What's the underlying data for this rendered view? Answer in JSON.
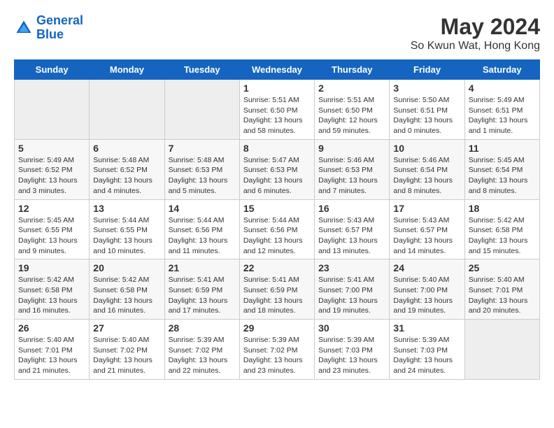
{
  "logo": {
    "line1": "General",
    "line2": "Blue"
  },
  "title": "May 2024",
  "subtitle": "So Kwun Wat, Hong Kong",
  "days_of_week": [
    "Sunday",
    "Monday",
    "Tuesday",
    "Wednesday",
    "Thursday",
    "Friday",
    "Saturday"
  ],
  "weeks": [
    [
      {
        "num": "",
        "detail": ""
      },
      {
        "num": "",
        "detail": ""
      },
      {
        "num": "",
        "detail": ""
      },
      {
        "num": "1",
        "detail": "Sunrise: 5:51 AM\nSunset: 6:50 PM\nDaylight: 13 hours\nand 58 minutes."
      },
      {
        "num": "2",
        "detail": "Sunrise: 5:51 AM\nSunset: 6:50 PM\nDaylight: 12 hours\nand 59 minutes."
      },
      {
        "num": "3",
        "detail": "Sunrise: 5:50 AM\nSunset: 6:51 PM\nDaylight: 13 hours\nand 0 minutes."
      },
      {
        "num": "4",
        "detail": "Sunrise: 5:49 AM\nSunset: 6:51 PM\nDaylight: 13 hours\nand 1 minute."
      }
    ],
    [
      {
        "num": "5",
        "detail": "Sunrise: 5:49 AM\nSunset: 6:52 PM\nDaylight: 13 hours\nand 3 minutes."
      },
      {
        "num": "6",
        "detail": "Sunrise: 5:48 AM\nSunset: 6:52 PM\nDaylight: 13 hours\nand 4 minutes."
      },
      {
        "num": "7",
        "detail": "Sunrise: 5:48 AM\nSunset: 6:53 PM\nDaylight: 13 hours\nand 5 minutes."
      },
      {
        "num": "8",
        "detail": "Sunrise: 5:47 AM\nSunset: 6:53 PM\nDaylight: 13 hours\nand 6 minutes."
      },
      {
        "num": "9",
        "detail": "Sunrise: 5:46 AM\nSunset: 6:53 PM\nDaylight: 13 hours\nand 7 minutes."
      },
      {
        "num": "10",
        "detail": "Sunrise: 5:46 AM\nSunset: 6:54 PM\nDaylight: 13 hours\nand 8 minutes."
      },
      {
        "num": "11",
        "detail": "Sunrise: 5:45 AM\nSunset: 6:54 PM\nDaylight: 13 hours\nand 8 minutes."
      }
    ],
    [
      {
        "num": "12",
        "detail": "Sunrise: 5:45 AM\nSunset: 6:55 PM\nDaylight: 13 hours\nand 9 minutes."
      },
      {
        "num": "13",
        "detail": "Sunrise: 5:44 AM\nSunset: 6:55 PM\nDaylight: 13 hours\nand 10 minutes."
      },
      {
        "num": "14",
        "detail": "Sunrise: 5:44 AM\nSunset: 6:56 PM\nDaylight: 13 hours\nand 11 minutes."
      },
      {
        "num": "15",
        "detail": "Sunrise: 5:44 AM\nSunset: 6:56 PM\nDaylight: 13 hours\nand 12 minutes."
      },
      {
        "num": "16",
        "detail": "Sunrise: 5:43 AM\nSunset: 6:57 PM\nDaylight: 13 hours\nand 13 minutes."
      },
      {
        "num": "17",
        "detail": "Sunrise: 5:43 AM\nSunset: 6:57 PM\nDaylight: 13 hours\nand 14 minutes."
      },
      {
        "num": "18",
        "detail": "Sunrise: 5:42 AM\nSunset: 6:58 PM\nDaylight: 13 hours\nand 15 minutes."
      }
    ],
    [
      {
        "num": "19",
        "detail": "Sunrise: 5:42 AM\nSunset: 6:58 PM\nDaylight: 13 hours\nand 16 minutes."
      },
      {
        "num": "20",
        "detail": "Sunrise: 5:42 AM\nSunset: 6:58 PM\nDaylight: 13 hours\nand 16 minutes."
      },
      {
        "num": "21",
        "detail": "Sunrise: 5:41 AM\nSunset: 6:59 PM\nDaylight: 13 hours\nand 17 minutes."
      },
      {
        "num": "22",
        "detail": "Sunrise: 5:41 AM\nSunset: 6:59 PM\nDaylight: 13 hours\nand 18 minutes."
      },
      {
        "num": "23",
        "detail": "Sunrise: 5:41 AM\nSunset: 7:00 PM\nDaylight: 13 hours\nand 19 minutes."
      },
      {
        "num": "24",
        "detail": "Sunrise: 5:40 AM\nSunset: 7:00 PM\nDaylight: 13 hours\nand 19 minutes."
      },
      {
        "num": "25",
        "detail": "Sunrise: 5:40 AM\nSunset: 7:01 PM\nDaylight: 13 hours\nand 20 minutes."
      }
    ],
    [
      {
        "num": "26",
        "detail": "Sunrise: 5:40 AM\nSunset: 7:01 PM\nDaylight: 13 hours\nand 21 minutes."
      },
      {
        "num": "27",
        "detail": "Sunrise: 5:40 AM\nSunset: 7:02 PM\nDaylight: 13 hours\nand 21 minutes."
      },
      {
        "num": "28",
        "detail": "Sunrise: 5:39 AM\nSunset: 7:02 PM\nDaylight: 13 hours\nand 22 minutes."
      },
      {
        "num": "29",
        "detail": "Sunrise: 5:39 AM\nSunset: 7:02 PM\nDaylight: 13 hours\nand 23 minutes."
      },
      {
        "num": "30",
        "detail": "Sunrise: 5:39 AM\nSunset: 7:03 PM\nDaylight: 13 hours\nand 23 minutes."
      },
      {
        "num": "31",
        "detail": "Sunrise: 5:39 AM\nSunset: 7:03 PM\nDaylight: 13 hours\nand 24 minutes."
      },
      {
        "num": "",
        "detail": ""
      }
    ]
  ]
}
